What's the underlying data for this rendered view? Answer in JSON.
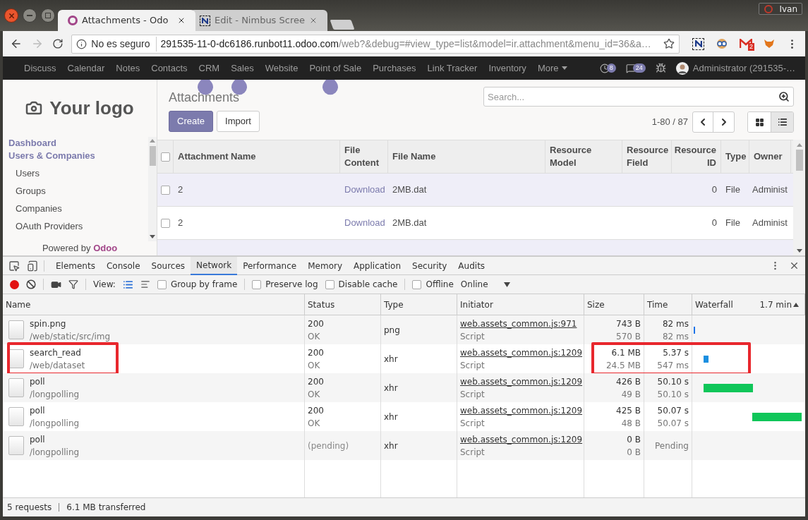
{
  "browser": {
    "tabs": [
      {
        "title": "Attachments - Odo",
        "selected": true
      },
      {
        "title": "Edit - Nimbus Scree",
        "selected": false
      }
    ],
    "profile": "Ivan",
    "security": "No es seguro",
    "url_host": "291535-11-0-dc6186.runbot11.odoo.com",
    "url_path": "/web?&debug=#view_type=list&model=ir.attachment&menu_id=36&a…",
    "mail_badge": "2"
  },
  "odoo": {
    "menu": [
      "Discuss",
      "Calendar",
      "Notes",
      "Contacts",
      "CRM",
      "Sales",
      "Website",
      "Point of Sale",
      "Purchases",
      "Link Tracker",
      "Inventory"
    ],
    "more": "More",
    "activity_count": "8",
    "message_count": "24",
    "user": "Administrator (291535-…",
    "logo": "Your logo",
    "sidebar": [
      {
        "label": "Dashboard",
        "kind": "section"
      },
      {
        "label": "Users & Companies",
        "kind": "section"
      },
      {
        "label": "Users",
        "kind": "item"
      },
      {
        "label": "Groups",
        "kind": "item"
      },
      {
        "label": "Companies",
        "kind": "item"
      },
      {
        "label": "OAuth Providers",
        "kind": "item"
      }
    ],
    "powered_by": "Powered by",
    "brand": "Odoo",
    "title": "Attachments",
    "create": "Create",
    "import": "Import",
    "search_placeholder": "Search...",
    "pager": "1-80 / 87",
    "views": [
      {
        "kind": "kanban",
        "selected": false
      },
      {
        "kind": "list",
        "selected": true
      }
    ],
    "select_all": {
      "checked": false
    },
    "columns": [
      "Attachment Name",
      "File Content",
      "File Name",
      "Resource Model",
      "Resource Field",
      "Resource ID",
      "Type",
      "Owner"
    ],
    "rows": [
      {
        "checked": false,
        "name": "2",
        "content": "Download",
        "file": "2MB.dat",
        "res_id": "0",
        "type": "File",
        "owner": "Administ"
      },
      {
        "checked": false,
        "name": "2",
        "content": "Download",
        "file": "2MB.dat",
        "res_id": "0",
        "type": "File",
        "owner": "Administ"
      }
    ]
  },
  "devtools": {
    "tabs": [
      {
        "label": "Elements",
        "selected": false
      },
      {
        "label": "Console",
        "selected": false
      },
      {
        "label": "Sources",
        "selected": false
      },
      {
        "label": "Network",
        "selected": true
      },
      {
        "label": "Performance",
        "selected": false
      },
      {
        "label": "Memory",
        "selected": false
      },
      {
        "label": "Application",
        "selected": false
      },
      {
        "label": "Security",
        "selected": false
      },
      {
        "label": "Audits",
        "selected": false
      }
    ],
    "recording": true,
    "view_label": "View:",
    "options": [
      {
        "label": "Group by frame",
        "checked": false
      },
      {
        "label": "Preserve log",
        "checked": false
      },
      {
        "label": "Disable cache",
        "checked": false
      },
      {
        "label": "Offline",
        "checked": false
      }
    ],
    "throttle": "Online",
    "columns": [
      "Name",
      "Status",
      "Type",
      "Initiator",
      "Size",
      "Time",
      "Waterfall"
    ],
    "sort_label": "1.7 min",
    "requests": [
      {
        "name": "spin.png",
        "path": "/web/static/src/img",
        "status": "200",
        "status_text": "OK",
        "type": "png",
        "initiator": "web.assets_common.js:971",
        "initiator_type": "Script",
        "size": "743 B",
        "resource_size": "570 B",
        "time": "82 ms",
        "latency": "82 ms",
        "highlighted": false,
        "color": "#1a73e8"
      },
      {
        "name": "search_read",
        "path": "/web/dataset",
        "status": "200",
        "status_text": "OK",
        "type": "xhr",
        "initiator": "web.assets_common.js:1209",
        "initiator_type": "Script",
        "size": "6.1 MB",
        "resource_size": "24.5 MB",
        "time": "5.37 s",
        "latency": "547 ms",
        "highlighted": true,
        "color": "#1a8fe0"
      },
      {
        "name": "poll",
        "path": "/longpolling",
        "status": "200",
        "status_text": "OK",
        "type": "xhr",
        "initiator": "web.assets_common.js:1209",
        "initiator_type": "Script",
        "size": "426 B",
        "resource_size": "49 B",
        "time": "50.10 s",
        "latency": "50.10 s",
        "highlighted": false,
        "color": "#0fc659"
      },
      {
        "name": "poll",
        "path": "/longpolling",
        "status": "200",
        "status_text": "OK",
        "type": "xhr",
        "initiator": "web.assets_common.js:1209",
        "initiator_type": "Script",
        "size": "425 B",
        "resource_size": "48 B",
        "time": "50.07 s",
        "latency": "50.07 s",
        "highlighted": false,
        "color": "#0fc659"
      },
      {
        "name": "poll",
        "path": "/longpolling",
        "status": "(pending)",
        "type": "xhr",
        "initiator": "web.assets_common.js:1209",
        "initiator_type": "Script",
        "size": "0 B",
        "resource_size": "0 B",
        "time": "Pending",
        "highlighted": false
      }
    ],
    "summary": [
      "5 requests",
      "6.1 MB transferred"
    ]
  }
}
